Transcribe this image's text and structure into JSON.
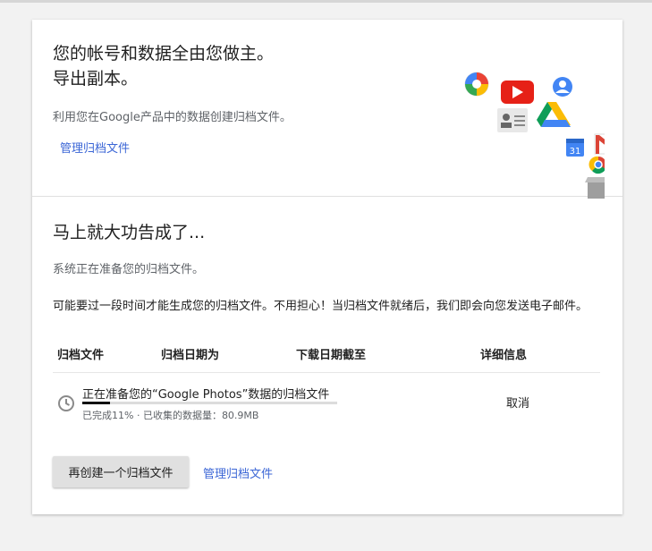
{
  "header": {
    "title_line1": "您的帐号和数据全由您做主。",
    "title_line2": "导出副本。",
    "subtitle": "利用您在Google产品中的数据创建归档文件。",
    "manage_link": "管理归档文件"
  },
  "illustration": {
    "icons": [
      "photos-icon",
      "youtube-icon",
      "account-icon",
      "contacts-icon",
      "drive-icon",
      "calendar-icon",
      "gmail-icon",
      "chrome-icon",
      "box-icon"
    ],
    "calendar_day": "31"
  },
  "status": {
    "heading": "马上就大功告成了...",
    "preparing": "系统正在准备您的归档文件。",
    "note": "可能要过一段时间才能生成您的归档文件。不用担心！当归档文件就绪后，我们即会向您发送电子邮件。"
  },
  "table": {
    "headers": [
      "归档文件",
      "归档日期为",
      "下载日期截至",
      "详细信息"
    ],
    "rows": [
      {
        "title": "正在准备您的“Google Photos”数据的归档文件",
        "progress": "已完成11% · 已收集的数据量：80.9MB",
        "progress_fraction": 0.11,
        "action": "取消"
      }
    ]
  },
  "actions": {
    "recreate_button": "再创建一个归档文件",
    "manage_link": "管理归档文件"
  },
  "colors": {
    "link": "#3b66d6",
    "button_bg": "#e0e0e0",
    "progress_fill": "#111111"
  }
}
